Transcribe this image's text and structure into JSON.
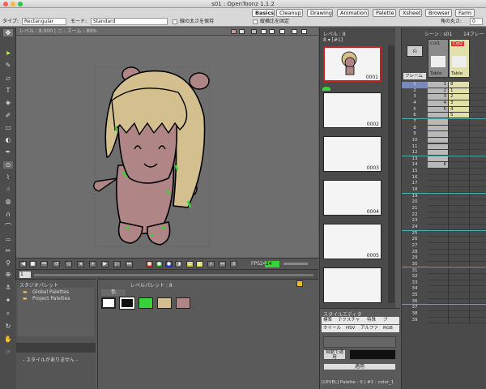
{
  "window": {
    "title": "s01 : OpenToonz 1.1.2"
  },
  "rooms": [
    "Basics",
    "Cleanup",
    "Drawing",
    "Animation",
    "Palette",
    "Xsheet",
    "Browser",
    "Farm"
  ],
  "tool_options": {
    "type_label": "タイプ:",
    "type_value": "Rectangular",
    "mode_label": "モード:",
    "mode_value": "Standard",
    "keep_thickness": "線の太さを保持",
    "fix_aspect": "縦横比を固定",
    "angle_label": "角の丸さ:",
    "angle_value": "0"
  },
  "viewer": {
    "header": "レベル : 8.000 | ニ : ズーム : 89%"
  },
  "viewer_controls": {
    "fps_label": "FPS",
    "fps_value": "24",
    "fps_current": "24",
    "frame_field": "1"
  },
  "studio_palette": {
    "title": "スタジオパレット",
    "items": [
      "Global Palettes",
      "Project Palettes"
    ],
    "empty_text": "- スタイルがありません -"
  },
  "level_palette": {
    "title": "レベルパレット : 8",
    "tab": "色"
  },
  "level_strip": {
    "title": "レベル : 8",
    "selector": "8 ▾ [#1]",
    "frame_numbers": [
      "0001",
      "0002",
      "0003",
      "0004",
      "0005"
    ]
  },
  "style_editor": {
    "title": "スタイルエディタ",
    "tabs_row1": [
      "標準",
      "テクスチャ",
      "特殊",
      "ブ"
    ],
    "tabs_row2": [
      "ホイール",
      "HSV",
      "アルファ",
      "RGB"
    ],
    "auto_apply": "自動で適用",
    "apply_button": "適用",
    "footer": "[LEVEL] Palette : 0 | #1 : color_1"
  },
  "xsheet": {
    "header": "シーン : s01",
    "frames_label": "14フレー",
    "columns": [
      {
        "name": "Col1",
        "sub": "Table"
      },
      {
        "name": "Col2",
        "sub": "Table"
      }
    ],
    "frame_dropdown": "フレーム",
    "rows": [
      "1",
      "2",
      "3",
      "4",
      "5",
      "6",
      "7",
      "8",
      "9",
      "10",
      "11",
      "12",
      "13",
      "14",
      "15",
      "16",
      "17",
      "18",
      "19",
      "20",
      "21",
      "22",
      "23",
      "24",
      "25",
      "26",
      "27",
      "28",
      "29",
      "30",
      "31",
      "32",
      "33",
      "34",
      "35",
      "36",
      "37",
      "38",
      "39"
    ],
    "col1_cells": [
      "1",
      "2",
      "3",
      "4",
      "5",
      "",
      "",
      "",
      "",
      "",
      "",
      "",
      "",
      "6"
    ],
    "col2_cells": [
      "8",
      "1",
      "2",
      "3",
      "4",
      "5"
    ]
  },
  "colors": {
    "hair": "#d4c08e",
    "skin": "#b08585",
    "accent_green": "#39d339",
    "selection_red": "#c82020",
    "cell_yellow": "#e0e0a8"
  }
}
